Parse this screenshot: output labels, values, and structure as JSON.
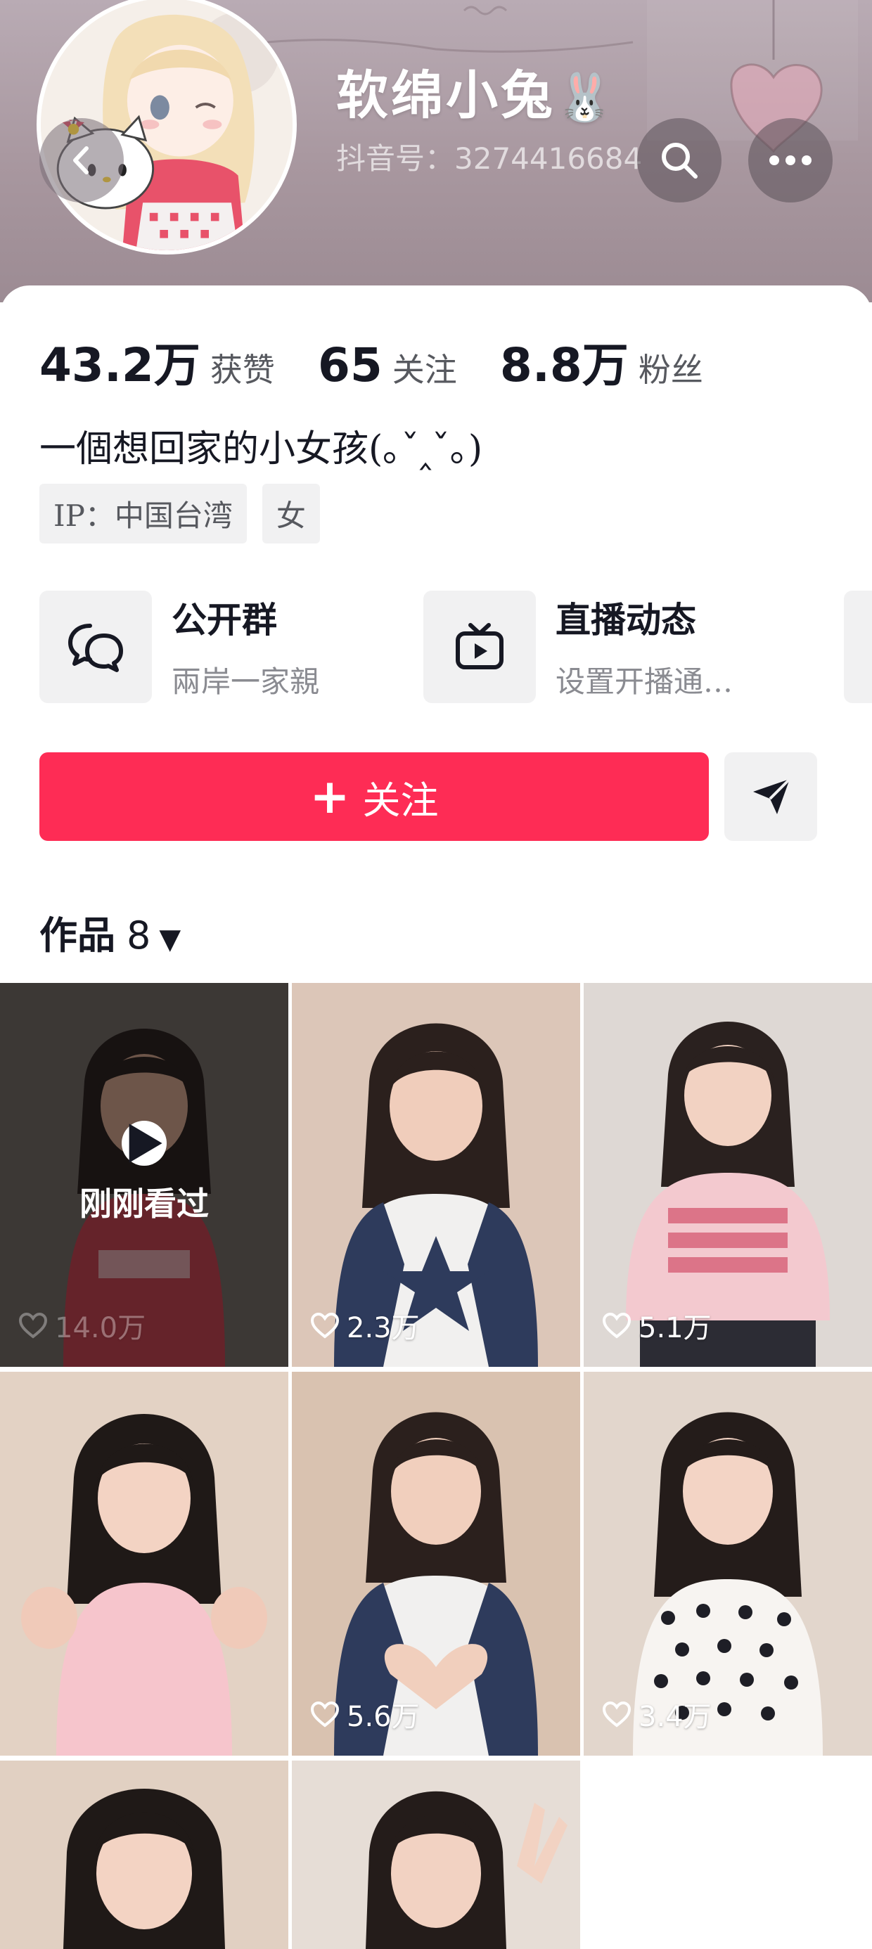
{
  "profile": {
    "nickname": "软绵小兔",
    "nickname_emoji": "🐰",
    "douyin_id": "抖音号：3274416684"
  },
  "header_actions": {
    "back_icon": "chevron-left-icon",
    "search_icon": "search-icon",
    "more_icon": "more-horizontal-icon"
  },
  "stats": {
    "likes_value": "43.2万",
    "likes_label": "获赞",
    "following_value": "65",
    "following_label": "关注",
    "followers_value": "8.8万",
    "followers_label": "粉丝"
  },
  "bio": "一個想回家的小女孩(｡ˇ‸ˇ｡)",
  "tags": {
    "ip": "IP：中国台湾",
    "gender": "女"
  },
  "features": [
    {
      "title": "公开群",
      "subtitle": "兩岸一家親",
      "icon": "chat-bubbles-icon"
    },
    {
      "title": "直播动态",
      "subtitle": "设置开播通…",
      "icon": "tv-play-icon"
    }
  ],
  "actions": {
    "follow_plus": "+",
    "follow_label": "关注",
    "share_icon": "send-icon"
  },
  "works_tab": {
    "label": "作品",
    "count": "8",
    "caret": "▼"
  },
  "videos": [
    {
      "likes": "14.0万",
      "recently_viewed": "刚刚看过"
    },
    {
      "likes": "2.3万"
    },
    {
      "likes": "5.1万"
    },
    {
      "likes": ""
    },
    {
      "likes": "5.6万"
    },
    {
      "likes": "3.4万"
    },
    {
      "likes": ""
    },
    {
      "likes": ""
    }
  ],
  "colors": {
    "accent": "#fe2c55",
    "header_bg": "#a8979f",
    "chip_bg": "#f1f1f2"
  }
}
